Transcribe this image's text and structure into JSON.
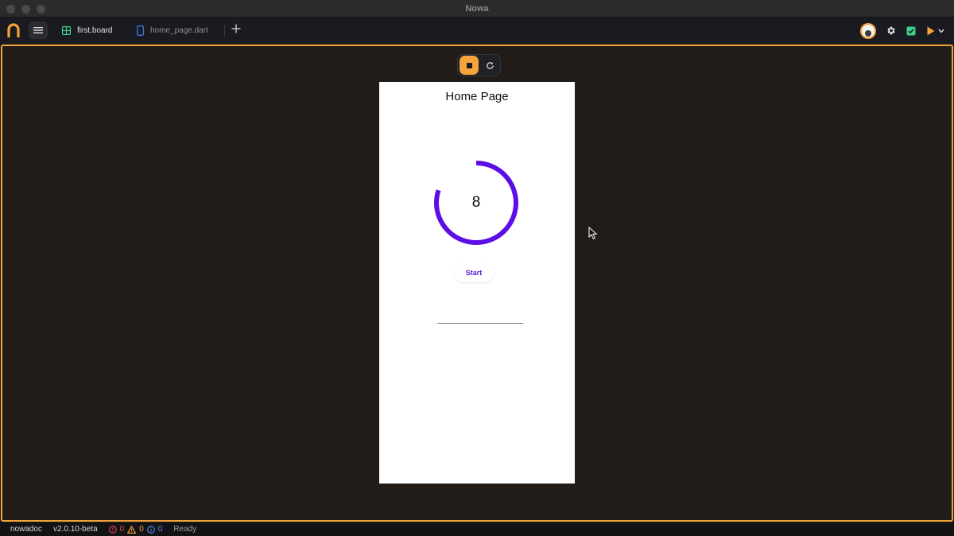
{
  "window": {
    "title": "Nowa"
  },
  "tabs": [
    {
      "label": "first.board",
      "icon": "board-grid-icon",
      "active": true
    },
    {
      "label": "home_page.dart",
      "icon": "phone-icon",
      "active": false
    }
  ],
  "colors": {
    "accent": "#f5a43a",
    "board_tab_icon": "#3fcf8e",
    "dart_tab_icon": "#3a7bd5",
    "progress": "#5d0ee6",
    "error": "#e5484d",
    "warning": "#f5a43a",
    "info": "#4f8ef7"
  },
  "phone_preview": {
    "page_title": "Home Page",
    "counter_value": "8",
    "progress_fraction": 0.8,
    "start_label": "Start"
  },
  "statusbar": {
    "project": "nowadoc",
    "version": "v2.0.10-beta",
    "errors": "0",
    "warnings": "0",
    "infos": "0",
    "status": "Ready"
  }
}
